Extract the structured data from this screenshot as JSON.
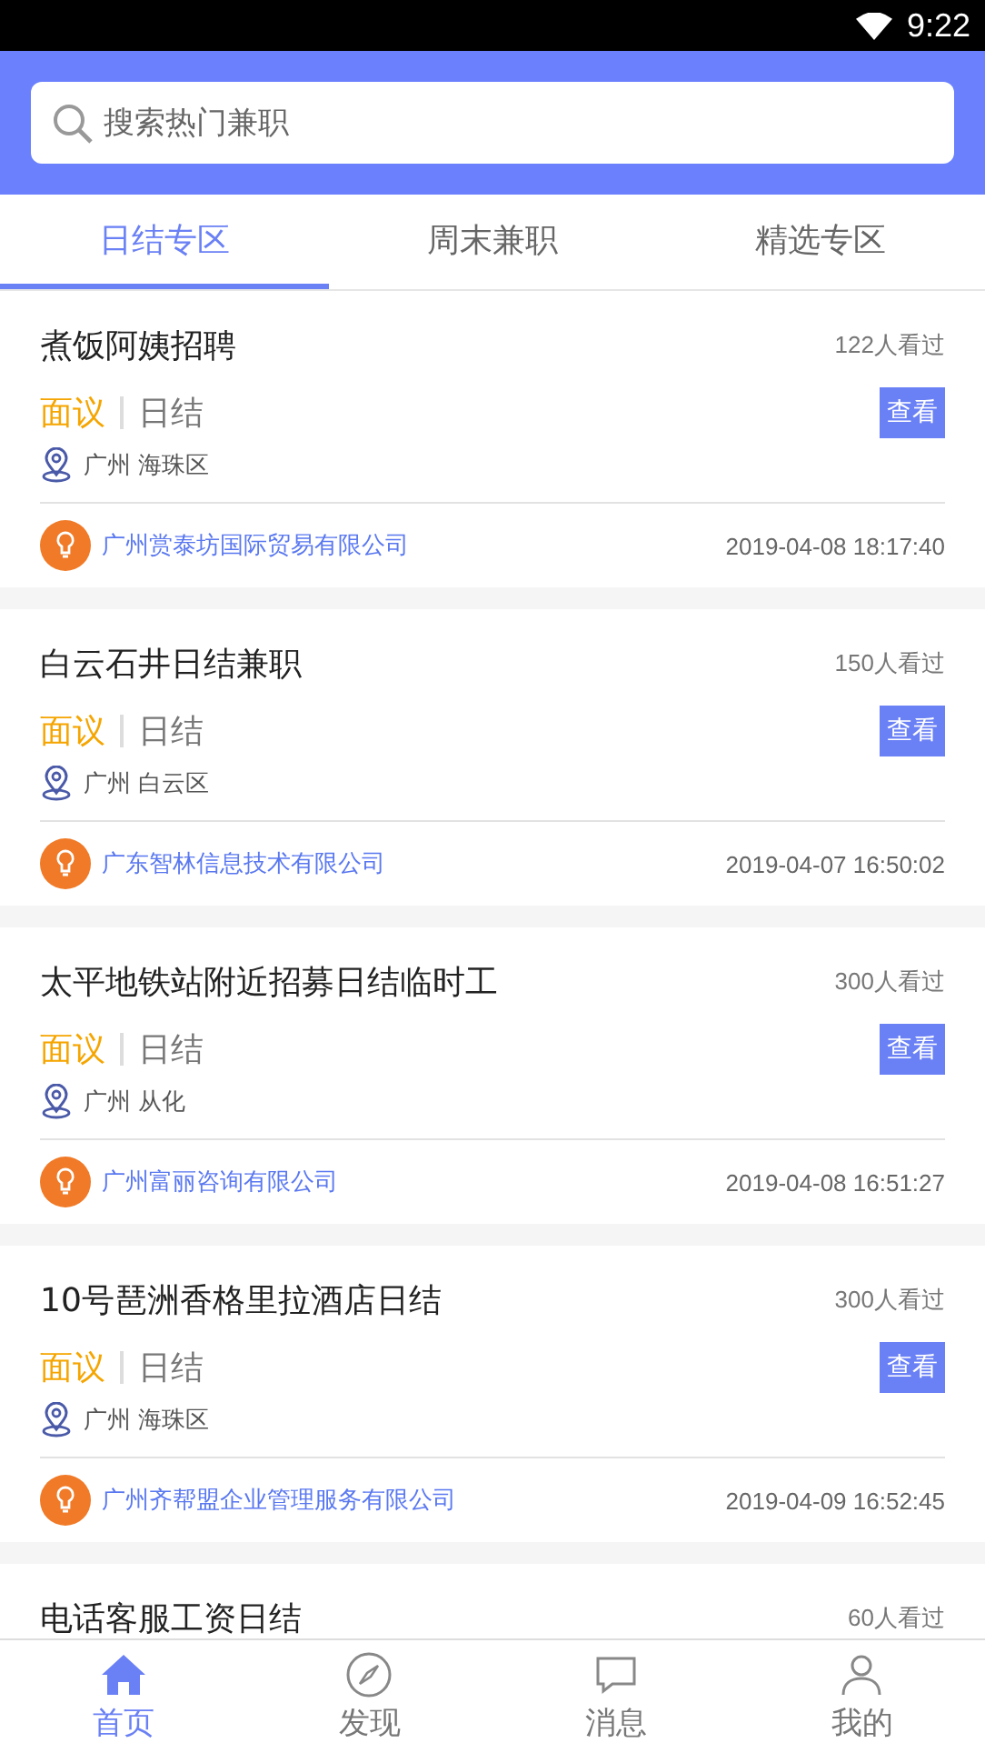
{
  "status_bar": {
    "time": "9:22"
  },
  "search": {
    "placeholder": "搜索热门兼职"
  },
  "tabs": [
    {
      "label": "日结专区",
      "selected": true
    },
    {
      "label": "周末兼职",
      "selected": false
    },
    {
      "label": "精选专区",
      "selected": false
    }
  ],
  "jobs": [
    {
      "title": "煮饭阿姨招聘",
      "views": "122人看过",
      "salary": "面议",
      "pay_type": "日结",
      "location": "广州 海珠区",
      "button": "查看",
      "company": "广州赏泰坊国际贸易有限公司",
      "time": "2019-04-08 18:17:40"
    },
    {
      "title": "白云石井日结兼职",
      "views": "150人看过",
      "salary": "面议",
      "pay_type": "日结",
      "location": "广州 白云区",
      "button": "查看",
      "company": "广东智林信息技术有限公司",
      "time": "2019-04-07 16:50:02"
    },
    {
      "title": "太平地铁站附近招募日结临时工",
      "views": "300人看过",
      "salary": "面议",
      "pay_type": "日结",
      "location": "广州 从化",
      "button": "查看",
      "company": "广州富丽咨询有限公司",
      "time": "2019-04-08 16:51:27"
    },
    {
      "title": "10号琶洲香格里拉酒店日结",
      "views": "300人看过",
      "salary": "面议",
      "pay_type": "日结",
      "location": "广州 海珠区",
      "button": "查看",
      "company": "广州齐帮盟企业管理服务有限公司",
      "time": "2019-04-09 16:52:45"
    },
    {
      "title": "电话客服工资日结",
      "views": "60人看过"
    }
  ],
  "bottom_nav": [
    {
      "kind": "home",
      "label": "首页",
      "selected": true
    },
    {
      "kind": "discover",
      "label": "发现",
      "selected": false
    },
    {
      "kind": "message",
      "label": "消息",
      "selected": false
    },
    {
      "kind": "profile",
      "label": "我的",
      "selected": false
    }
  ]
}
